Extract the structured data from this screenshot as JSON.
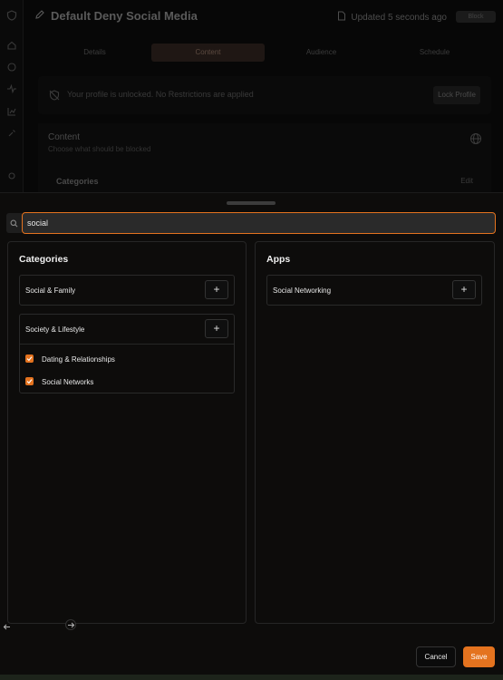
{
  "background": {
    "title": "Default Deny Social Media",
    "updated": "Updated 5 seconds ago",
    "block_label": "Block",
    "tabs": [
      {
        "label": "Details"
      },
      {
        "label": "Content"
      },
      {
        "label": "Audience"
      },
      {
        "label": "Schedule"
      }
    ],
    "active_tab": "Content",
    "lock_message": "Your profile is unlocked.  No Restrictions are applied",
    "lock_button": "Lock Profile",
    "content_title": "Content",
    "content_subtitle": "Choose what should be blocked",
    "categories_label": "Categories",
    "edit_label": "Edit"
  },
  "search": {
    "value": "social",
    "icon": "search-icon"
  },
  "categories_panel": {
    "title": "Categories",
    "groups": [
      {
        "label": "Social & Family",
        "expanded": false,
        "items": []
      },
      {
        "label": "Society & Lifestyle",
        "expanded": true,
        "items": [
          {
            "label": "Dating & Relationships",
            "checked": true
          },
          {
            "label": "Social Networks",
            "checked": true
          }
        ]
      }
    ]
  },
  "apps_panel": {
    "title": "Apps",
    "groups": [
      {
        "label": "Social Networking",
        "expanded": false
      }
    ]
  },
  "add_symbol": "+",
  "footer": {
    "cancel": "Cancel",
    "save": "Save"
  },
  "colors": {
    "accent": "#e4731f",
    "panel_border": "#262626"
  }
}
